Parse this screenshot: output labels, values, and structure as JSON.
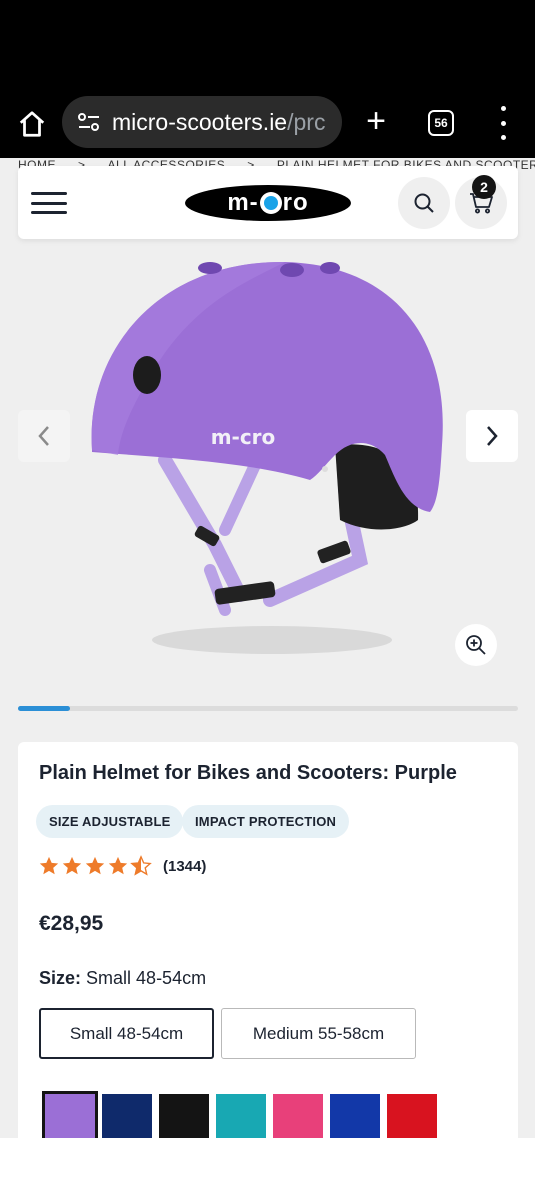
{
  "browser": {
    "url_main": "micro-scooters.ie",
    "url_rest": "/prc",
    "tab_count": "56"
  },
  "breadcrumb": [
    "HOME",
    ">",
    "ALL ACCESSORIES",
    ">",
    "PLAIN HELMET FOR BIKES AND SCOOTERS"
  ],
  "header": {
    "logo_text": "m-cro",
    "cart_count": "2"
  },
  "gallery": {
    "image_alt": "Purple plain micro helmet",
    "helmet_brand": "m-cro",
    "slide_progress": 0.1
  },
  "product": {
    "title": "Plain Helmet for Bikes and Scooters: Purple",
    "tags": [
      "SIZE ADJUSTABLE",
      "IMPACT PROTECTION"
    ],
    "rating": 4.5,
    "rating_count": "(1344)",
    "price": "€28,95",
    "size_label": "Size:",
    "size_selected": "Small 48-54cm",
    "sizes": [
      "Small 48-54cm",
      "Medium 55-58cm"
    ],
    "swatches": [
      "#9b6fd6",
      "#0f2a6b",
      "#141414",
      "#18a8b3",
      "#e8407a",
      "#1238a8",
      "#d8131f"
    ]
  },
  "colors": {
    "accent": "#2b8fd6",
    "star": "#ee7b2a",
    "tag_bg": "#e6f1f6"
  }
}
